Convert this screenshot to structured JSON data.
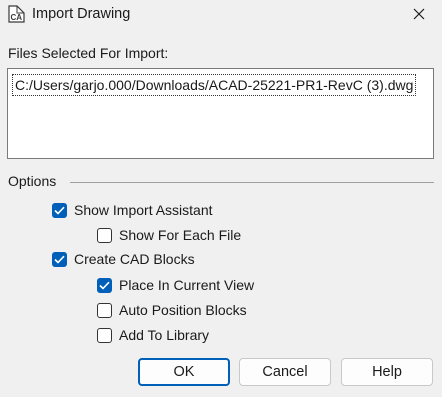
{
  "window": {
    "title": "Import Drawing",
    "icon": "cad-app-icon",
    "close_icon": "close-icon"
  },
  "files": {
    "label": "Files Selected For Import:",
    "items": [
      "C:/Users/garjo.000/Downloads/ACAD-25221-PR1-RevC (3).dwg"
    ]
  },
  "options": {
    "label": "Options",
    "show_import_assistant": {
      "label": "Show Import Assistant",
      "checked": true
    },
    "show_for_each_file": {
      "label": "Show For Each File",
      "checked": false
    },
    "create_cad_blocks": {
      "label": "Create CAD Blocks",
      "checked": true
    },
    "place_in_current_view": {
      "label": "Place In Current View",
      "checked": true
    },
    "auto_position_blocks": {
      "label": "Auto Position Blocks",
      "checked": false
    },
    "add_to_library": {
      "label": "Add To Library",
      "checked": false
    }
  },
  "buttons": {
    "ok": "OK",
    "cancel": "Cancel",
    "help": "Help"
  },
  "colors": {
    "accent": "#005fb8",
    "background": "#f0f0f0"
  }
}
